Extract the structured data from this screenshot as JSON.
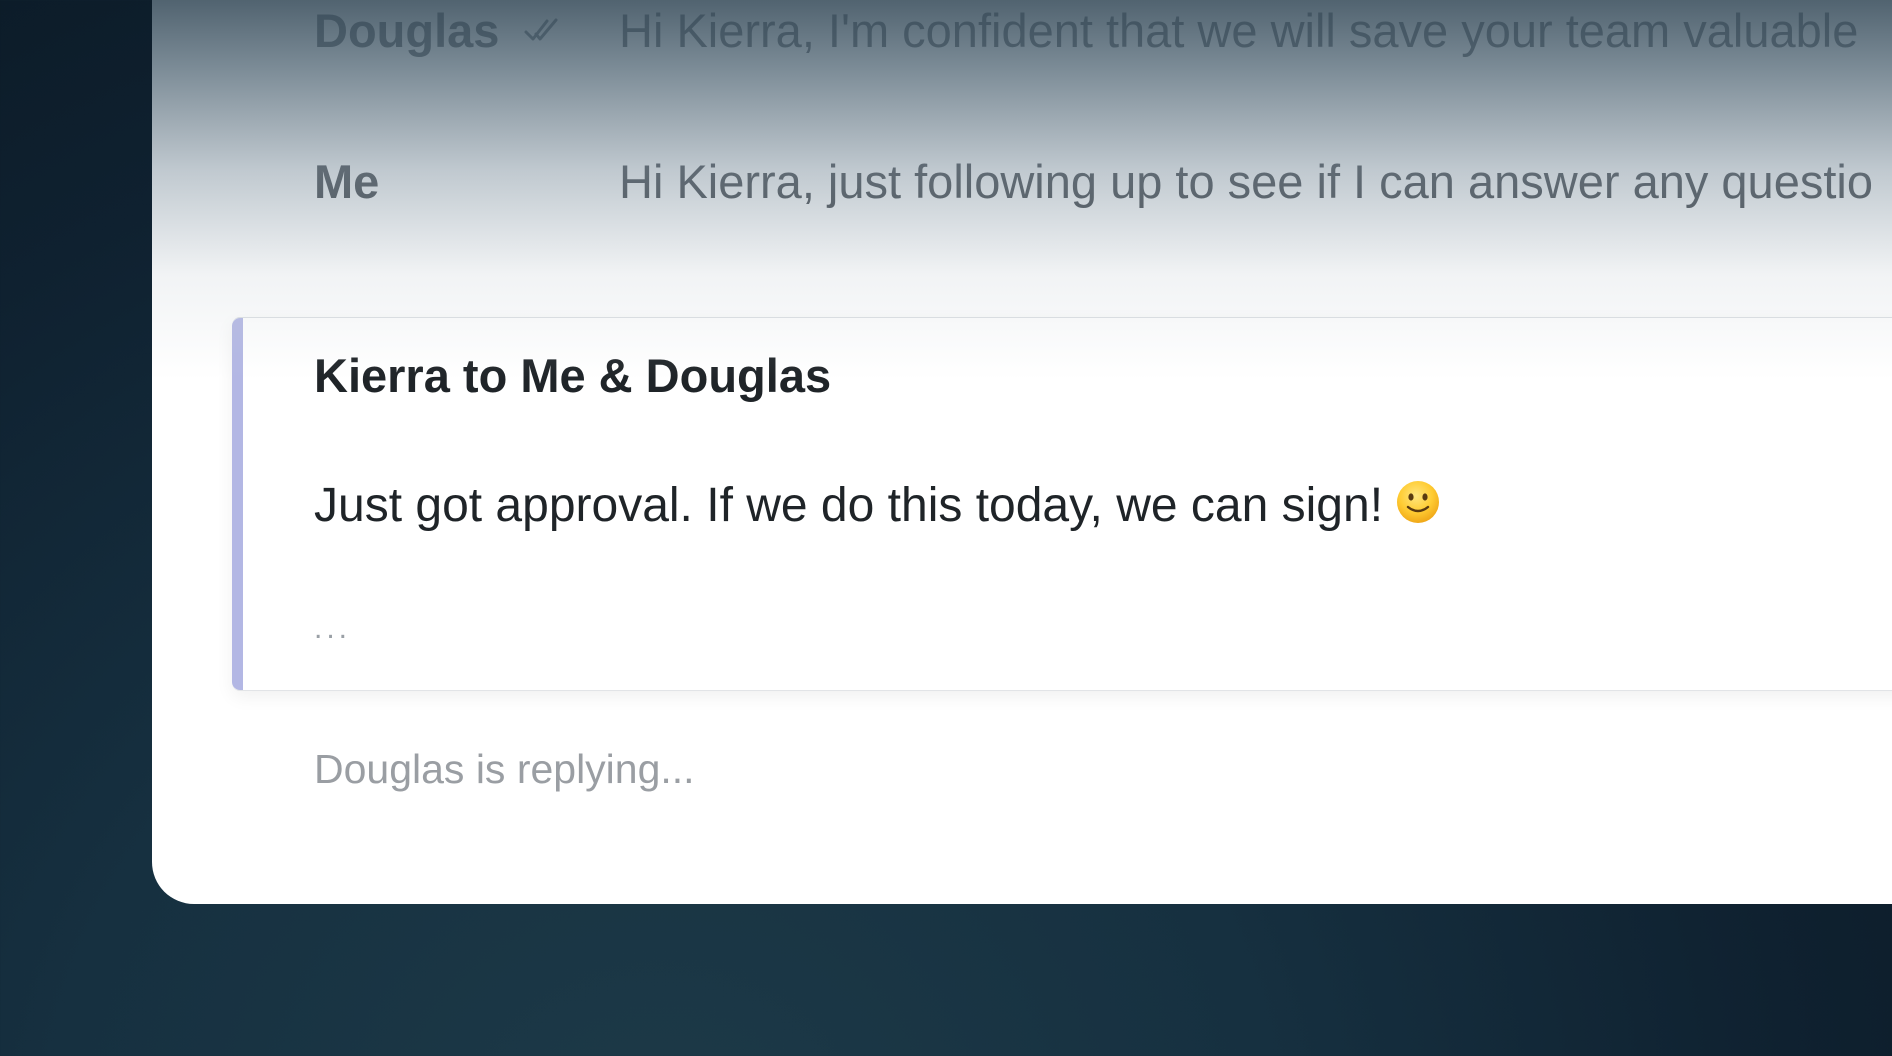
{
  "thread": {
    "rows": [
      {
        "sender": "Douglas",
        "preview": "Hi Kierra, I'm confident that we will save your team valuable",
        "read_receipt_icon": "double-check-icon"
      },
      {
        "sender": "Me",
        "preview": "Hi Kierra, just following up to see if I can answer any questio"
      }
    ]
  },
  "message": {
    "header": "Kierra to Me & Douglas",
    "body": "Just got approval. If we do this today, we can sign!",
    "emoji_icon": "slightly-smiling-face-icon",
    "ellipsis": "...",
    "accent_color": "#b3b7e4"
  },
  "status": {
    "typing": "Douglas is replying..."
  }
}
